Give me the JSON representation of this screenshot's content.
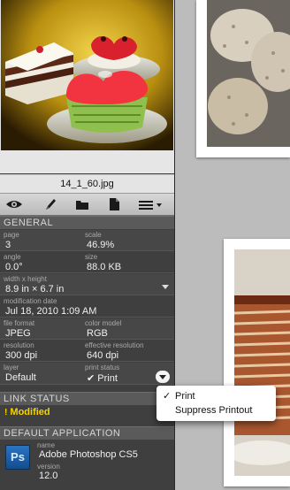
{
  "thumbnail": {
    "filename": "14_1_60.jpg"
  },
  "toolbar": {
    "icons": [
      "eye-icon",
      "pencil-icon",
      "folder-icon",
      "document-icon",
      "list-icon"
    ]
  },
  "general": {
    "header": "GENERAL",
    "page_label": "page",
    "page_value": "3",
    "scale_label": "scale",
    "scale_value": "46.9%",
    "angle_label": "angle",
    "angle_value": "0.0°",
    "size_label": "size",
    "size_value": "88.0 KB",
    "wh_label": "width x height",
    "wh_value": "8.9 in × 6.7 in",
    "moddate_label": "modification date",
    "moddate_value": "Jul 18, 2010 1:09 AM",
    "format_label": "file format",
    "format_value": "JPEG",
    "colormodel_label": "color model",
    "colormodel_value": "RGB",
    "resolution_label": "resolution",
    "resolution_value": "300 dpi",
    "effres_label": "effective resolution",
    "effres_value": "640 dpi",
    "layer_label": "layer",
    "layer_value": "Default",
    "printstatus_label": "print status",
    "printstatus_value": "✔ Print"
  },
  "link_status": {
    "header": "LINK STATUS",
    "value": "Modified"
  },
  "default_app": {
    "header": "DEFAULT APPLICATION",
    "logo_text": "Ps",
    "name_label": "name",
    "name_value": "Adobe Photoshop CS5",
    "version_label": "version",
    "version_value": "12.0"
  },
  "print_menu": {
    "items": [
      {
        "check": "✓",
        "label": "Print"
      },
      {
        "check": "",
        "label": "Suppress Printout"
      }
    ]
  },
  "colors": {
    "modified": "#f5d200",
    "panel_bg": "#3f3f3f",
    "section_header": "#5a5a5a"
  }
}
